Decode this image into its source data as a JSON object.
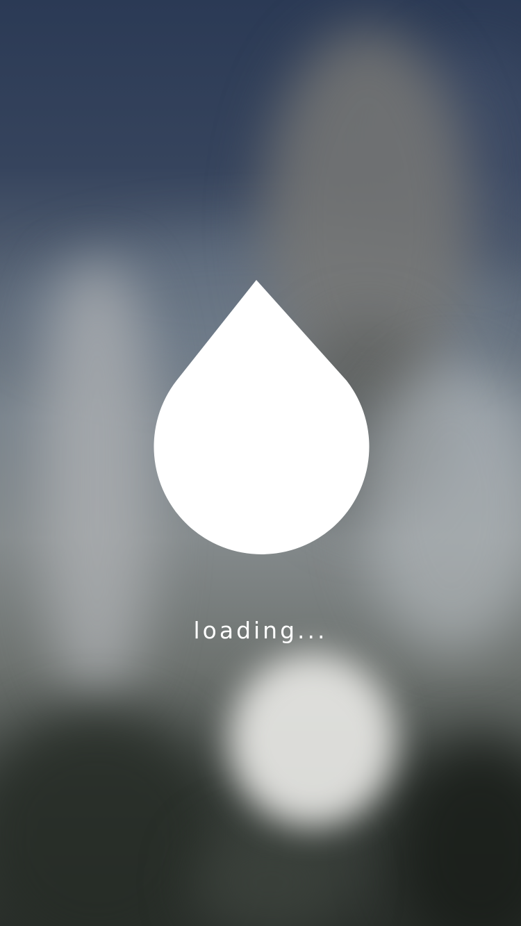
{
  "loader": {
    "icon": "water-drop-icon",
    "text": "loading..."
  },
  "colors": {
    "drop": "#ffffff",
    "text": "#ffffff"
  }
}
